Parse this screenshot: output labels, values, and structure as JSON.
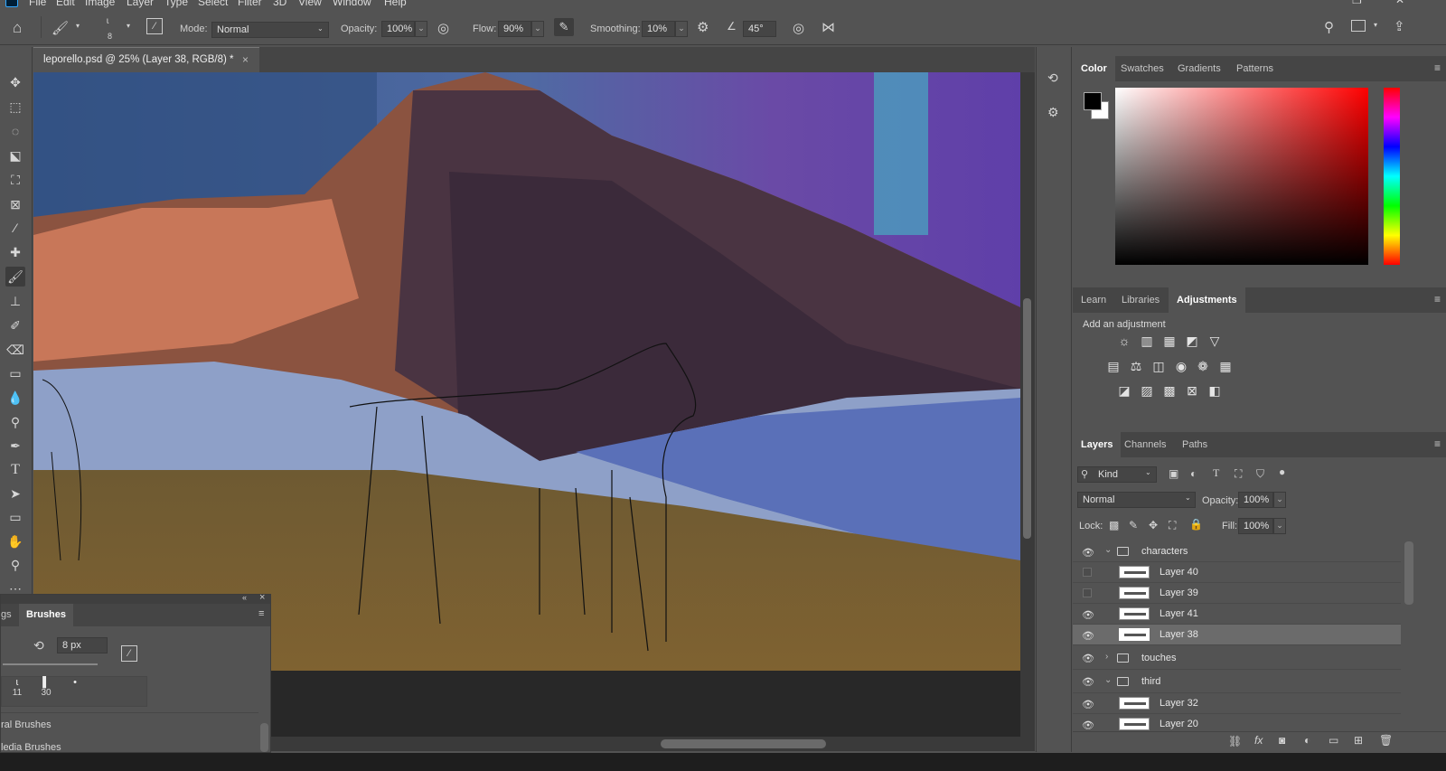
{
  "menu": [
    "File",
    "Edit",
    "Image",
    "Layer",
    "Type",
    "Select",
    "Filter",
    "3D",
    "View",
    "Window",
    "Help"
  ],
  "options": {
    "brush_size": "8",
    "mode_label": "Mode:",
    "mode_value": "Normal",
    "opacity_label": "Opacity:",
    "opacity_value": "100%",
    "flow_label": "Flow:",
    "flow_value": "90%",
    "smoothing_label": "Smoothing:",
    "smoothing_value": "10%",
    "angle_value": "45°"
  },
  "document": {
    "tab_title": "leporello.psd @ 25% (Layer 38, RGB/8) *",
    "close_glyph": "×"
  },
  "color_panel": {
    "tabs": [
      "Color",
      "Swatches",
      "Gradients",
      "Patterns"
    ],
    "active_tab": "Color",
    "foreground": "#000000",
    "background": "#ffffff"
  },
  "adjust_panel": {
    "tabs": [
      "Learn",
      "Libraries",
      "Adjustments"
    ],
    "active_tab": "Adjustments",
    "hint": "Add an adjustment"
  },
  "layers_panel": {
    "tabs": [
      "Layers",
      "Channels",
      "Paths"
    ],
    "active_tab": "Layers",
    "filter_kind": "Kind",
    "blend_mode": "Normal",
    "opacity_label": "Opacity:",
    "opacity_value": "100%",
    "lock_label": "Lock:",
    "fill_label": "Fill:",
    "fill_value": "100%",
    "layers": [
      {
        "name": "characters",
        "type": "group",
        "expanded": true,
        "visible": true
      },
      {
        "name": "Layer 40",
        "type": "layer",
        "visible": false
      },
      {
        "name": "Layer 39",
        "type": "layer",
        "visible": false
      },
      {
        "name": "Layer 41",
        "type": "layer",
        "visible": true
      },
      {
        "name": "Layer 38",
        "type": "layer",
        "visible": true,
        "selected": true
      },
      {
        "name": "touches",
        "type": "group",
        "expanded": false,
        "visible": true
      },
      {
        "name": "third",
        "type": "group",
        "expanded": true,
        "visible": true
      },
      {
        "name": "Layer 32",
        "type": "layer",
        "visible": true
      },
      {
        "name": "Layer 20",
        "type": "layer",
        "visible": true
      }
    ]
  },
  "brushes_panel": {
    "tab_partial": "gs",
    "tab_active": "Brushes",
    "size_value": "8 px",
    "presets": [
      "11",
      "30",
      ""
    ],
    "groups": [
      "ral Brushes",
      "ledia Brushes"
    ]
  }
}
